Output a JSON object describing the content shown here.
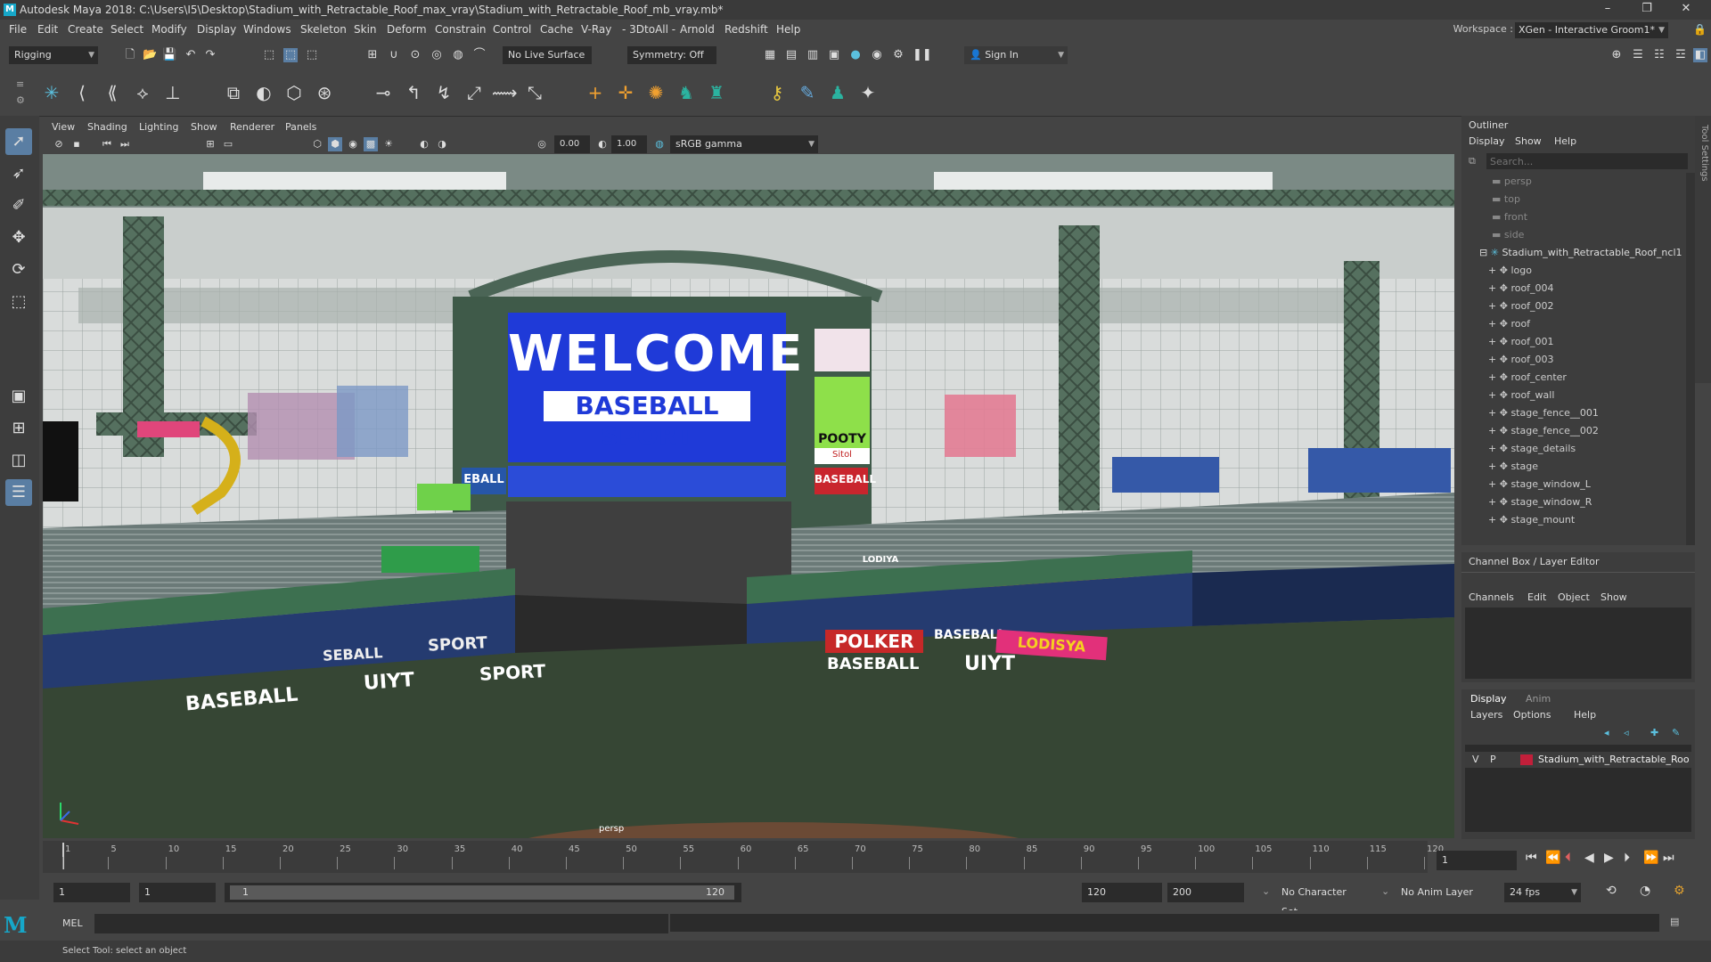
{
  "title_bar": {
    "title": "Autodesk Maya 2018: C:\\Users\\I5\\Desktop\\Stadium_with_Retractable_Roof_max_vray\\Stadium_with_Retractable_Roof_mb_vray.mb*"
  },
  "menu": [
    "File",
    "Edit",
    "Create",
    "Select",
    "Modify",
    "Display",
    "Windows",
    "Skeleton",
    "Skin",
    "Deform",
    "Constrain",
    "Control",
    "Cache",
    "V-Ray",
    "- 3DtoAll -",
    "Arnold",
    "Redshift",
    "Help"
  ],
  "workspace": {
    "label": "Workspace :",
    "value": "XGen - Interactive Groom1*"
  },
  "toolbar": {
    "menu_set": "Rigging",
    "live_surface": "No Live Surface",
    "symmetry": "Symmetry: Off",
    "sign_in": "Sign In"
  },
  "panel_menu": [
    "View",
    "Shading",
    "Lighting",
    "Show",
    "Renderer",
    "Panels"
  ],
  "panel_toolbar": {
    "exposure": "0.00",
    "gamma": "1.00",
    "color_space": "sRGB gamma"
  },
  "viewport": {
    "camera_label": "persp",
    "scoreboard": {
      "line1": "WELCOME",
      "line2": "BASEBALL SPORT",
      "side1": "POOTY",
      "side2": "Sitol",
      "small_left": "EBALL",
      "small_right": "BASEBALL"
    },
    "signs": {
      "baseball_left": "BASEBALL",
      "uiyt_left": "UIYT",
      "sport_left": "SPORT",
      "sport_mid": "SPORT",
      "seball": "SEBALL",
      "polker": "POLKER",
      "baseball_right": "BASEBALL",
      "baseball_right2": "BASEBALL",
      "uiyt_right": "UIYT",
      "lodisya": "LODISYA",
      "lodiya_small": "LODIYA"
    }
  },
  "outliner": {
    "title": "Outliner",
    "menu": [
      "Display",
      "Show",
      "Help"
    ],
    "search_placeholder": "Search...",
    "cameras": [
      "persp",
      "top",
      "front",
      "side"
    ],
    "root": "Stadium_with_Retractable_Roof_ncl1",
    "items": [
      "logo",
      "roof_004",
      "roof_002",
      "roof",
      "roof_001",
      "roof_003",
      "roof_center",
      "roof_wall",
      "stage_fence__001",
      "stage_fence__002",
      "stage_details",
      "stage",
      "stage_window_L",
      "stage_window_R",
      "stage_mount"
    ]
  },
  "channel_box": {
    "title": "Channel Box / Layer Editor",
    "menu": [
      "Channels",
      "Edit",
      "Object",
      "Show"
    ]
  },
  "layer_editor": {
    "tabs": [
      "Display",
      "Anim"
    ],
    "menu": [
      "Layers",
      "Options",
      "Help"
    ],
    "layer": {
      "v": "V",
      "p": "P",
      "name": "Stadium_with_Retractable_Roo"
    }
  },
  "timeline": {
    "ticks": [
      "1",
      "5",
      "10",
      "15",
      "20",
      "25",
      "30",
      "35",
      "40",
      "45",
      "50",
      "55",
      "60",
      "65",
      "70",
      "75",
      "80",
      "85",
      "90",
      "95",
      "100",
      "105",
      "110",
      "115",
      "120"
    ],
    "current_frame": "1"
  },
  "range": {
    "start": "1",
    "inner_start": "1",
    "slider_start": "1",
    "slider_end": "120",
    "end": "120",
    "anim_end": "200",
    "character_set": "No Character Set",
    "anim_layer": "No Anim Layer",
    "fps": "24 fps"
  },
  "command_line": {
    "label": "MEL"
  },
  "help_line": {
    "text": "Select Tool: select an object"
  },
  "side_label": "Tool Settings"
}
